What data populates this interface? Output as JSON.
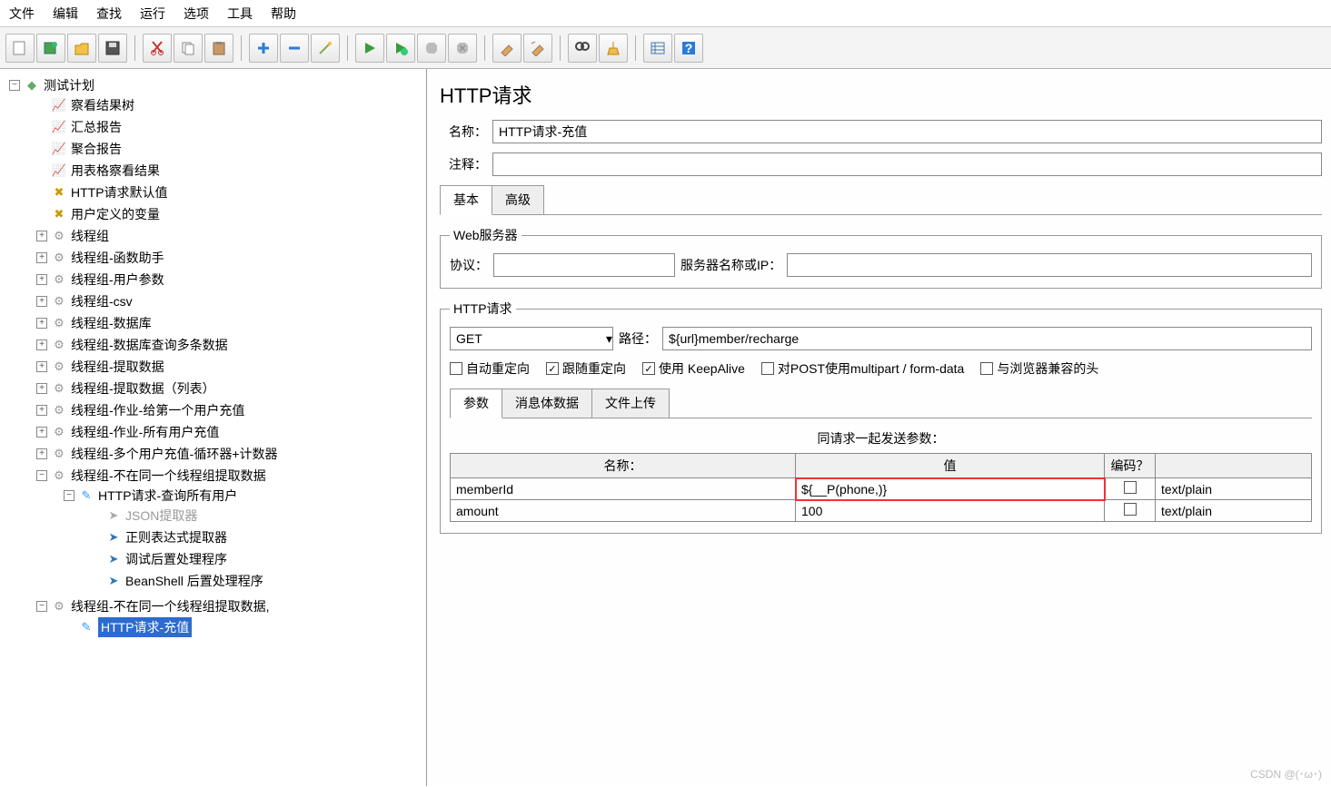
{
  "menu": {
    "items": [
      "文件",
      "编辑",
      "查找",
      "运行",
      "选项",
      "工具",
      "帮助"
    ]
  },
  "toolbar": {
    "icons": [
      "new",
      "template",
      "open",
      "save",
      "cut",
      "copy",
      "paste",
      "plus",
      "minus",
      "wand",
      "run",
      "run-thread",
      "stop",
      "stop-all",
      "clear",
      "clear-all",
      "search",
      "sweep",
      "toggle",
      "help"
    ]
  },
  "tree": {
    "root": {
      "label": "测试计划",
      "icon": "plan",
      "exp": "-"
    },
    "children": [
      {
        "label": "察看结果树",
        "icon": "report"
      },
      {
        "label": "汇总报告",
        "icon": "report"
      },
      {
        "label": "聚合报告",
        "icon": "report"
      },
      {
        "label": "用表格察看结果",
        "icon": "report"
      },
      {
        "label": "HTTP请求默认值",
        "icon": "tool"
      },
      {
        "label": "用户定义的变量",
        "icon": "tool"
      }
    ],
    "groups": [
      {
        "label": "线程组",
        "exp": "+"
      },
      {
        "label": "线程组-函数助手",
        "exp": "+"
      },
      {
        "label": "线程组-用户参数",
        "exp": "+"
      },
      {
        "label": "线程组-csv",
        "exp": "+"
      },
      {
        "label": "线程组-数据库",
        "exp": "+"
      },
      {
        "label": "线程组-数据库查询多条数据",
        "exp": "+"
      },
      {
        "label": "线程组-提取数据",
        "exp": "+"
      },
      {
        "label": "线程组-提取数据（列表）",
        "exp": "+"
      },
      {
        "label": "线程组-作业-给第一个用户充值",
        "exp": "+"
      },
      {
        "label": "线程组-作业-所有用户充值",
        "exp": "+"
      },
      {
        "label": "线程组-多个用户充值-循环器+计数器",
        "exp": "+"
      }
    ],
    "open1": {
      "label": "线程组-不在同一个线程组提取数据",
      "exp": "-",
      "sub": {
        "label": "HTTP请求-查询所有用户",
        "icon": "http",
        "exp": "-",
        "ch": [
          {
            "label": "JSON提取器",
            "icon": "arrow",
            "grey": true
          },
          {
            "label": "正则表达式提取器",
            "icon": "arrow"
          },
          {
            "label": "调试后置处理程序",
            "icon": "arrow"
          },
          {
            "label": "BeanShell 后置处理程序",
            "icon": "arrow"
          }
        ]
      }
    },
    "open2": {
      "label": "线程组-不在同一个线程组提取数据,",
      "exp": "-",
      "sub": {
        "label": "HTTP请求-充值",
        "icon": "http",
        "selected": true
      }
    }
  },
  "editor": {
    "title": "HTTP请求",
    "form": {
      "name_label": "名称：",
      "name_value": "HTTP请求-充值",
      "comment_label": "注释：",
      "comment_value": ""
    },
    "tabs": [
      "基本",
      "高级"
    ],
    "web_server": {
      "legend": "Web服务器",
      "proto_label": "协议：",
      "proto_value": "",
      "server_label": "服务器名称或IP：",
      "server_value": ""
    },
    "http_req": {
      "legend": "HTTP请求",
      "method": "GET",
      "path_label": "路径：",
      "path_value": "${url}member/recharge",
      "checks": [
        {
          "label": "自动重定向",
          "checked": false
        },
        {
          "label": "跟随重定向",
          "checked": true
        },
        {
          "label": "使用 KeepAlive",
          "checked": true
        },
        {
          "label": "对POST使用multipart / form-data",
          "checked": false
        },
        {
          "label": "与浏览器兼容的头",
          "checked": false
        }
      ],
      "subtabs": [
        "参数",
        "消息体数据",
        "文件上传"
      ],
      "param_title": "同请求一起发送参数：",
      "headers": {
        "name": "名称：",
        "value": "值",
        "enc": "编码？",
        "ct": ""
      },
      "rows": [
        {
          "name": "memberId",
          "value": "${__P(phone,)}",
          "enc": false,
          "ct": "text/plain",
          "hl": true
        },
        {
          "name": "amount",
          "value": "100",
          "enc": false,
          "ct": "text/plain",
          "hl": false
        }
      ]
    }
  },
  "footer": "CSDN @(･ω･)"
}
